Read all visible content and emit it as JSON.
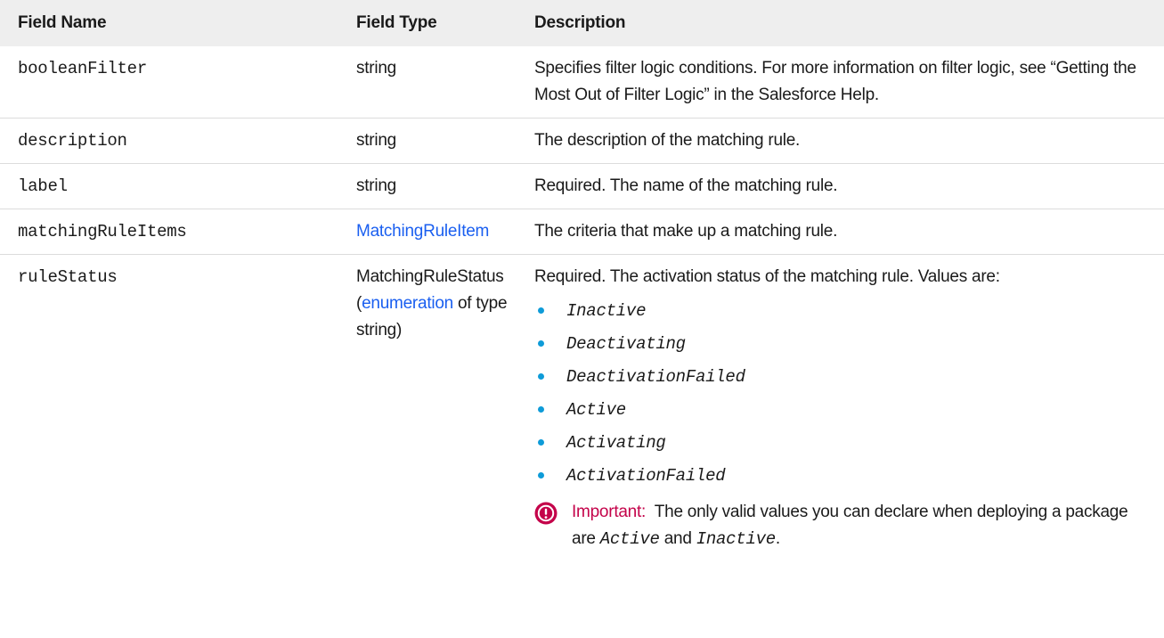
{
  "table": {
    "headers": {
      "field_name": "Field Name",
      "field_type": "Field Type",
      "description": "Description"
    },
    "rows": [
      {
        "name": "booleanFilter",
        "type": "string",
        "description": "Specifies filter logic conditions. For more information on filter logic, see “Getting the Most Out of Filter Logic” in the Salesforce Help."
      },
      {
        "name": "description",
        "type": "string",
        "description": "The description of the matching rule."
      },
      {
        "name": "label",
        "type": "string",
        "description": "Required. The name of the matching rule."
      },
      {
        "name": "matchingRuleItems",
        "type_link": "MatchingRuleItem",
        "description": "The criteria that make up a matching rule."
      },
      {
        "name": "ruleStatus",
        "type_prefix": "MatchingRuleStatus (",
        "type_link": "enumeration",
        "type_suffix": " of type string)",
        "description": "Required. The activation status of the matching rule. Values are:",
        "values": [
          "Inactive",
          "Deactivating",
          "DeactivationFailed",
          "Active",
          "Activating",
          "ActivationFailed"
        ],
        "note": {
          "icon": "important-icon",
          "label": "Important:",
          "text_before": "The only valid values you can declare when deploying a package are",
          "value_1": "Active",
          "joiner": "and",
          "value_2": "Inactive",
          "text_after": "."
        }
      }
    ]
  },
  "colors": {
    "header_bg": "#eeeeee",
    "link": "#1a5ff0",
    "bullet": "#0e9bd8",
    "important": "#c4034a"
  }
}
